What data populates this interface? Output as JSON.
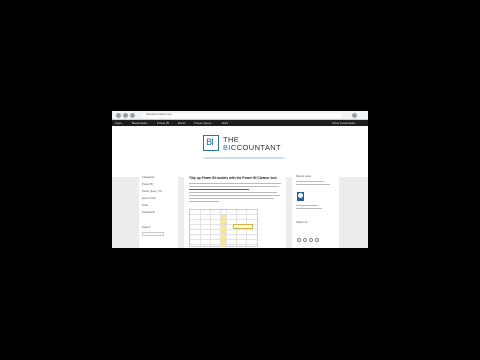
{
  "browser": {
    "url": "thebiccountant.com"
  },
  "bookmarks": [
    "Apps",
    "Bookmarks",
    "Power BI",
    "Excel",
    "Power Query",
    "DAX",
    "Other bookmarks"
  ],
  "site": {
    "logo_mark": "BI",
    "logo_line1": "THE",
    "logo_line2_prefix": "BI",
    "logo_line2_suffix": "CCOUNTANT",
    "brand_color": "#2a6fa8"
  },
  "sidebar_left": {
    "items": [
      "Categories",
      "Power BI",
      "Power Query / M",
      "Excel / DAX",
      "Tools",
      "Downloads"
    ],
    "search_label": "Search"
  },
  "post": {
    "title": "Tidy up Power BI models with the Power BI Cleaner tool"
  },
  "sidebar_right": {
    "heading": "Recent posts",
    "follow_label": "Follow me"
  }
}
